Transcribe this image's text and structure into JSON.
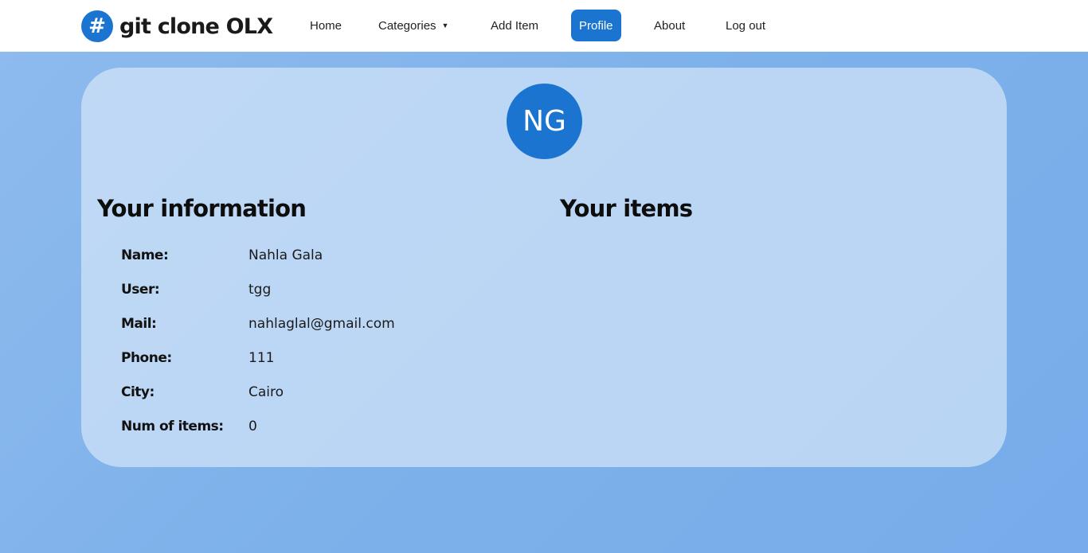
{
  "app": {
    "logo_icon": "#",
    "logo_text": "git clone OLX"
  },
  "nav": {
    "home": "Home",
    "categories": "Categories",
    "categories_caret": "▼",
    "add_item": "Add Item",
    "profile": "Profile",
    "about": "About",
    "logout": "Log out"
  },
  "profile": {
    "initials": "NG",
    "info_title": "Your information",
    "items_title": "Your items",
    "fields": [
      {
        "label": "Name:",
        "value": "Nahla Gala"
      },
      {
        "label": "User:",
        "value": "tgg"
      },
      {
        "label": "Mail:",
        "value": "nahlaglal@gmail.com"
      },
      {
        "label": "Phone:",
        "value": "111"
      },
      {
        "label": "City:",
        "value": "Cairo"
      },
      {
        "label": "Num of items:",
        "value": "0"
      }
    ]
  },
  "colors": {
    "accent": "#1b75d0",
    "background": "#7db1ea",
    "navbar": "#ffffff"
  }
}
